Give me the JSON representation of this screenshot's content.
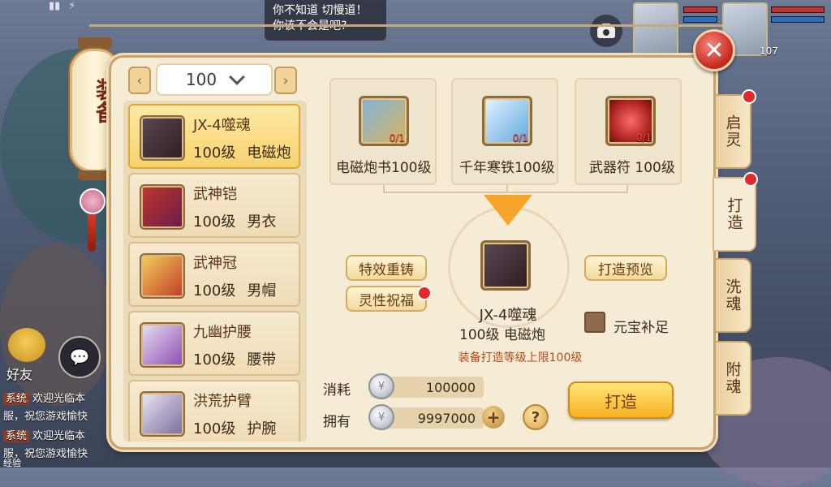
{
  "scene": {
    "speech_text": "你不知道 切慢道！你该不会是吧?",
    "portrait_level": "107",
    "friend_label": "好友",
    "system_lines": [
      {
        "tag": "系统",
        "text": "欢迎光临本"
      },
      {
        "tag": "",
        "text": "服，祝您游戏愉快"
      },
      {
        "tag": "系统",
        "text": "欢迎光临本"
      },
      {
        "tag": "",
        "text": "服，祝您游戏愉快"
      }
    ],
    "bottom_label": "经验"
  },
  "lantern": {
    "title": "装备"
  },
  "level_selector": {
    "value": "100"
  },
  "items": [
    {
      "name": "JX-4噬魂",
      "level": "100级",
      "type": "电磁炮",
      "selected": true,
      "icon": "red-gun-icon"
    },
    {
      "name": "武神铠",
      "level": "100级",
      "type": "男衣",
      "selected": false,
      "icon": "armor-icon"
    },
    {
      "name": "武神冠",
      "level": "100级",
      "type": "男帽",
      "selected": false,
      "icon": "helmet-icon"
    },
    {
      "name": "九幽护腰",
      "level": "100级",
      "type": "腰带",
      "selected": false,
      "icon": "belt-icon"
    },
    {
      "name": "洪荒护臂",
      "level": "100级",
      "type": "护腕",
      "selected": false,
      "icon": "bracer-icon"
    }
  ],
  "materials": [
    {
      "name": "电磁炮书100级",
      "count": "0/1",
      "icon": "scroll-icon"
    },
    {
      "name": "千年寒铁100级",
      "count": "0/1",
      "icon": "ice-iron-icon"
    },
    {
      "name": "武器符   100级",
      "count": "0/1",
      "icon": "red-talisman-icon"
    }
  ],
  "result": {
    "name": "JX-4噬魂",
    "sub": "100级 电磁炮"
  },
  "buttons": {
    "effect_recast": "特效重铸",
    "spirit_bless": "灵性祝福",
    "preview": "打造预览",
    "forge": "打造"
  },
  "yuanbao_label": "元宝补足",
  "limit_text": "装备打造等级上限100级",
  "costs": {
    "consume_label": "消耗",
    "consume_value": "100000",
    "own_label": "拥有",
    "own_value": "9997000"
  },
  "tabs": [
    {
      "label": "启灵",
      "badge": true,
      "active": false
    },
    {
      "label": "打造",
      "badge": true,
      "active": true
    },
    {
      "label": "洗魂",
      "badge": false,
      "active": false
    },
    {
      "label": "附魂",
      "badge": false,
      "active": false
    }
  ],
  "colors": {
    "accent_red": "#e02a2a",
    "gold": "#f5b321",
    "panel": "#f6ecd6"
  }
}
